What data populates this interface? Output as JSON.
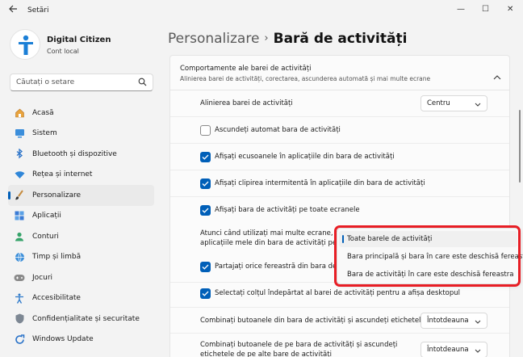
{
  "app": {
    "title": "Setări"
  },
  "window": {
    "minimize": "—",
    "maximize": "☐",
    "close": "✕"
  },
  "profile": {
    "name": "Digital Citizen",
    "account": "Cont local"
  },
  "search": {
    "placeholder": "Căutați o setare"
  },
  "sidebar": {
    "items": [
      {
        "label": "Acasă",
        "icon": "home-icon"
      },
      {
        "label": "Sistem",
        "icon": "system-icon"
      },
      {
        "label": "Bluetooth și dispozitive",
        "icon": "bluetooth-icon"
      },
      {
        "label": "Rețea și internet",
        "icon": "network-icon"
      },
      {
        "label": "Personalizare",
        "icon": "brush-icon",
        "active": true
      },
      {
        "label": "Aplicații",
        "icon": "apps-icon"
      },
      {
        "label": "Conturi",
        "icon": "person-icon"
      },
      {
        "label": "Timp și limbă",
        "icon": "globe-icon"
      },
      {
        "label": "Jocuri",
        "icon": "gamepad-icon"
      },
      {
        "label": "Accesibilitate",
        "icon": "accessibility-icon"
      },
      {
        "label": "Confidențialitate și securitate",
        "icon": "shield-icon"
      },
      {
        "label": "Windows Update",
        "icon": "update-icon"
      }
    ]
  },
  "breadcrumb": {
    "parent": "Personalizare",
    "separator": "›",
    "current": "Bară de activități"
  },
  "section": {
    "title": "Comportamente ale barei de activități",
    "subtitle": "Alinierea barei de activități, corectarea, ascunderea automată și mai multe ecrane"
  },
  "settings": {
    "alignment_label": "Alinierea barei de activități",
    "alignment_value": "Centru",
    "autohide_label": "Ascundeți automat bara de activități",
    "badges_label": "Afișați ecusoanele în aplicațiile din bara de activități",
    "flashing_label": "Afișați clipirea intermitentă în aplicațiile din bara de activități",
    "all_displays_label": "Afișați bara de activități pe toate ecranele",
    "multi_display_label_1": "Atunci când utilizați mai multe ecrane, afișa",
    "multi_display_label_2": "aplicațiile mele din bara de activități pe",
    "share_window_label": "Partajați orice fereastră din bara de activ",
    "far_corner_label": "Selectați colțul îndepărtat al barei de activități pentru a afișa desktopul",
    "combine_label": "Combinați butoanele din bara de activități și ascundeți etichetele",
    "combine_value": "Întotdeauna",
    "combine_other_label_1": "Combinați butoanele de pe bara de activități și ascundeți",
    "combine_other_label_2": "etichetele de pe alte bare de activități",
    "combine_other_value": "Întotdeauna"
  },
  "dropdown": {
    "options": [
      "Toate barele de activități",
      "Bara principală și bara în care este deschisă fereastra",
      "Bara de activități în care este deschisă fereastra"
    ],
    "selected_index": 0
  },
  "colors": {
    "accent": "#005fb8",
    "highlight": "#e81e25"
  }
}
